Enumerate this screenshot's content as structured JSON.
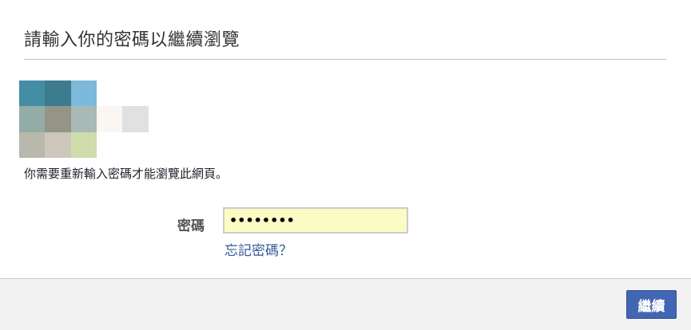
{
  "dialog": {
    "title": "請輸入你的密碼以繼續瀏覽",
    "message": "你需要重新輸入密碼才能瀏覽此網頁。",
    "password": {
      "label": "密碼",
      "value": "••••••••"
    },
    "forgot_link": "忘記密碼？",
    "continue_label": "繼續"
  },
  "colors": {
    "accent": "#4266b2",
    "link": "#365899",
    "input_fill": "#fbfcc3",
    "footer_bg": "#f2f2f2"
  }
}
